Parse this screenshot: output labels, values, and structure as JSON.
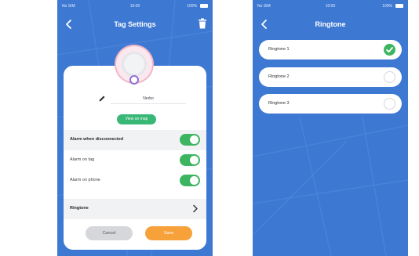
{
  "status_bar": {
    "carrier": "No SIM",
    "time": "10:00",
    "battery": "100%"
  },
  "tag_settings": {
    "title": "Tag Settings",
    "tag_name": "Nerbo",
    "view_on_map_label": "View on map",
    "rows": [
      {
        "label": "Alarm when disconnected",
        "toggle_on": true
      },
      {
        "label": "Alarm on tag",
        "toggle_on": true
      },
      {
        "label": "Alarm on phone",
        "toggle_on": true
      }
    ],
    "ringtone_label": "Ringtone",
    "cancel_label": "Cancel",
    "save_label": "Save"
  },
  "ringtone_screen": {
    "title": "Ringtone",
    "options": [
      {
        "label": "Ringtone 1",
        "selected": true
      },
      {
        "label": "Ringtone 2",
        "selected": false
      },
      {
        "label": "Ringtone 3",
        "selected": false
      }
    ]
  },
  "colors": {
    "background_blue": "#3d78d2",
    "toggle_green": "#3db560",
    "map_button_green": "#38b776",
    "save_orange": "#f6a13a",
    "cancel_gray": "#d6d7da"
  },
  "icons": [
    "back-arrow-icon",
    "trash-icon",
    "pencil-icon",
    "chevron-right-icon",
    "checkmark-icon",
    "battery-icon"
  ]
}
